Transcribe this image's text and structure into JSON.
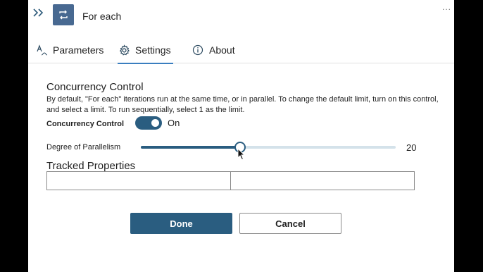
{
  "header": {
    "title": "For each",
    "more_label": "...",
    "icons": {
      "collapse": "double-chevron-right-icon",
      "operation": "loop-icon",
      "more": "ellipsis-icon"
    }
  },
  "tabs": [
    {
      "label": "Parameters",
      "icon": "parameters-icon",
      "active": false
    },
    {
      "label": "Settings",
      "icon": "gear-icon",
      "active": true
    },
    {
      "label": "About",
      "icon": "info-icon",
      "active": false
    }
  ],
  "concurrency": {
    "section_title": "Concurrency Control",
    "description": "By default, \"For each\" iterations run at the same time, or in parallel. To change the default limit, turn on this control, and select a limit. To run sequentially, select 1 as the limit.",
    "toggle_label": "Concurrency Control",
    "toggle_state": "On",
    "toggle_on": true,
    "degree_label": "Degree of Parallelism",
    "degree_value": "20",
    "degree_fraction": 0.39
  },
  "tracked_properties": {
    "title": "Tracked Properties",
    "key_value": "",
    "value_value": ""
  },
  "buttons": {
    "done": "Done",
    "cancel": "Cancel"
  },
  "colors": {
    "accent": "#2a5d80",
    "operation_icon_bg": "#486991",
    "tab_underline": "#3a7ebf"
  }
}
